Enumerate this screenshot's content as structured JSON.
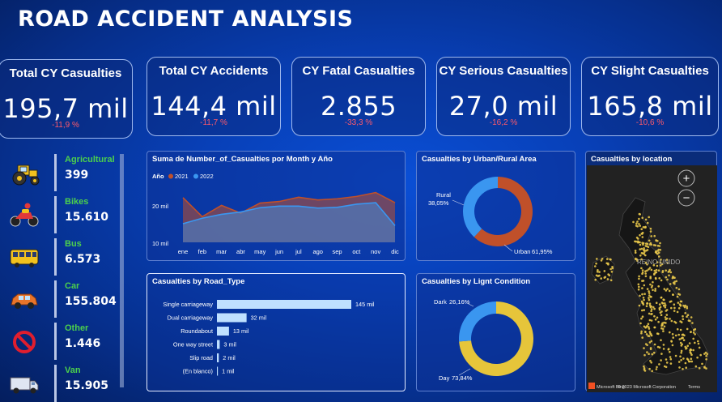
{
  "title": "ROAD ACCIDENT ANALYSIS",
  "colors": {
    "series2021": "#c0502a",
    "series2022": "#3a96f0",
    "donut_yellow": "#e6c53a",
    "delta_red": "#ff5a6a",
    "map_dots": "#e9c84a"
  },
  "kpis": [
    {
      "label": "Total CY Casualties",
      "value": "195,7 mil",
      "delta": "-11,9 %"
    },
    {
      "label": "Total CY Accidents",
      "value": "144,4 mil",
      "delta": "-11,7 %"
    },
    {
      "label": "CY Fatal Casualties",
      "value": "2.855",
      "delta": "-33,3 %"
    },
    {
      "label": "CY Serious Casualties",
      "value": "27,0 mil",
      "delta": "-16,2 %"
    },
    {
      "label": "CY Slight Casualties",
      "value": "165,8 mil",
      "delta": "-10,6 %"
    }
  ],
  "vehicles": [
    {
      "name": "Agricultural",
      "value": "399",
      "icon": "tractor-icon"
    },
    {
      "name": "Bikes",
      "value": "15.610",
      "icon": "motorbike-icon"
    },
    {
      "name": "Bus",
      "value": "6.573",
      "icon": "bus-icon"
    },
    {
      "name": "Car",
      "value": "155.804",
      "icon": "car-icon"
    },
    {
      "name": "Other",
      "value": "1.446",
      "icon": "prohibited-icon"
    },
    {
      "name": "Van",
      "value": "15.905",
      "icon": "van-icon"
    }
  ],
  "area_chart": {
    "title": "Suma de Number_of_Casualties por Month y Año",
    "legend_title": "Año",
    "chart_data": {
      "type": "area",
      "categories": [
        "ene",
        "feb",
        "mar",
        "abr",
        "may",
        "jun",
        "jul",
        "ago",
        "sep",
        "oct",
        "nov",
        "dic"
      ],
      "series": [
        {
          "name": "2021",
          "values": [
            19.5,
            14.6,
            17.5,
            15.5,
            18.1,
            18.5,
            19.6,
            18.9,
            19.2,
            19.8,
            20.8,
            18.2
          ]
        },
        {
          "name": "2022",
          "values": [
            12.8,
            14.2,
            15.2,
            15.8,
            16.9,
            17.3,
            17.3,
            16.8,
            17.0,
            17.8,
            18.2,
            12.3
          ]
        }
      ],
      "ylim": [
        8,
        23
      ],
      "y_ticks": [
        "10 mil",
        "20 mil"
      ]
    }
  },
  "urban_chart": {
    "title": "Casualties by Urban/Rural Area",
    "chart_data": {
      "type": "pie",
      "labels": [
        "Rural",
        "Urban"
      ],
      "values": [
        38.05,
        61.95
      ],
      "display": [
        "38,05%",
        "61,95%"
      ]
    }
  },
  "road_chart": {
    "title": "Casualties by Road_Type",
    "chart_data": {
      "type": "bar",
      "categories": [
        "Single carriageway",
        "Dual carriageway",
        "Roundabout",
        "One way street",
        "Slip road",
        "(En blanco)"
      ],
      "values": [
        145,
        32,
        13,
        3,
        2,
        1
      ],
      "labels": [
        "145 mil",
        "32 mil",
        "13 mil",
        "3 mil",
        "2 mil",
        "1 mil"
      ]
    }
  },
  "light_chart": {
    "title": "Casualties by Lignt Condition",
    "chart_data": {
      "type": "pie",
      "labels": [
        "Dark",
        "Day"
      ],
      "values": [
        26.16,
        73.84
      ],
      "display": [
        "26,16%",
        "73,84%"
      ]
    }
  },
  "map": {
    "title": "Casualties by location",
    "region_label": "REINO UNIDO",
    "zoom_in": "+",
    "zoom_out": "−",
    "attribution": "© 2023 Microsoft Corporation",
    "provider": "Microsoft Bing",
    "terms": "Terms"
  }
}
